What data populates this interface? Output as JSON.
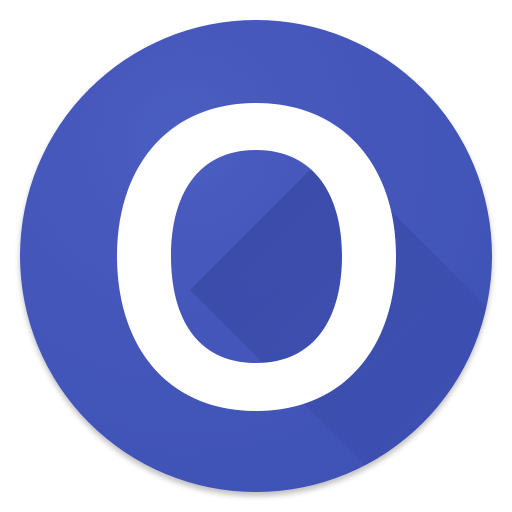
{
  "icon": {
    "name": "letter-o-app-icon",
    "glyph": "O",
    "colors": {
      "circle": "#3F51B5",
      "circle_highlight": "#4A5CC0",
      "long_shadow": "#2E3D94",
      "glyph": "#FFFFFF",
      "background": "#FFFFFF"
    }
  }
}
